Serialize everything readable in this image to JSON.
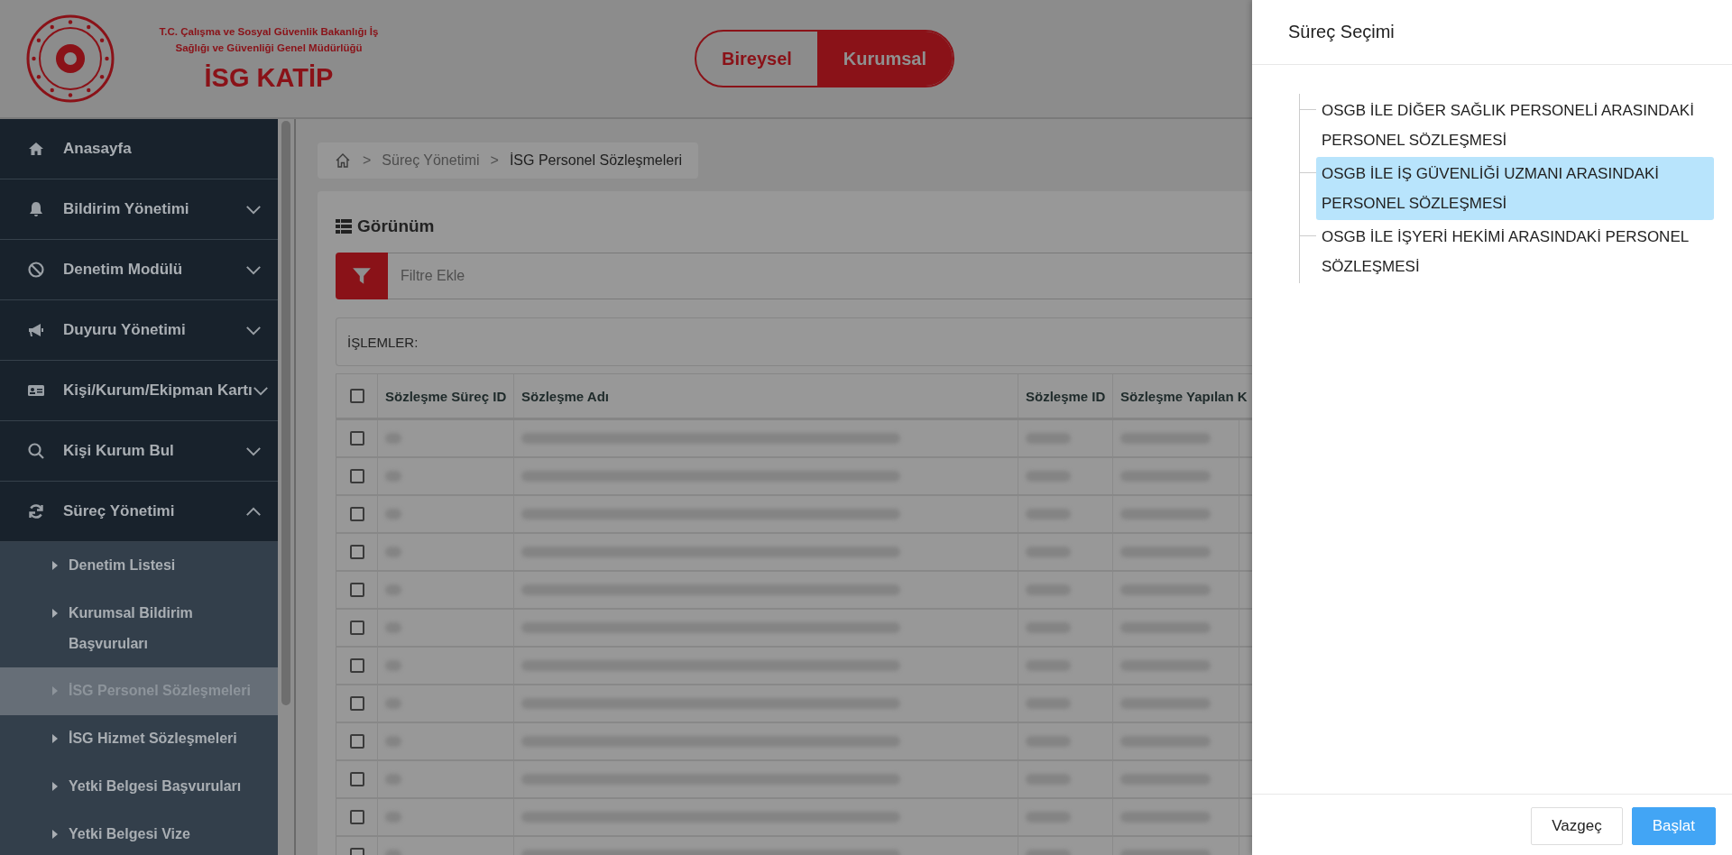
{
  "header": {
    "ministry": "T.C. Çalışma ve Sosyal Güvenlik Bakanlığı İş Sağlığı ve Güvenliği Genel Müdürlüğü",
    "app_name": "İSG KATİP",
    "toggle": [
      {
        "label": "Bireysel",
        "selected": false
      },
      {
        "label": "Kurumsal",
        "selected": true
      }
    ]
  },
  "sidebar": {
    "items": [
      {
        "label": "Anasayfa",
        "kind": "link"
      },
      {
        "label": "Bildirim Yönetimi",
        "kind": "group",
        "expanded": false
      },
      {
        "label": "Denetim Modülü",
        "kind": "group",
        "expanded": false
      },
      {
        "label": "Duyuru Yönetimi",
        "kind": "group",
        "expanded": false
      },
      {
        "label": "Kişi/Kurum/Ekipman Kartı",
        "kind": "group",
        "expanded": false
      },
      {
        "label": "Kişi Kurum Bul",
        "kind": "group",
        "expanded": false
      },
      {
        "label": "Süreç Yönetimi",
        "kind": "group",
        "expanded": true,
        "children": [
          {
            "label": "Denetim Listesi",
            "selected": false
          },
          {
            "label": "Kurumsal Bildirim Başvuruları",
            "selected": false
          },
          {
            "label": "İSG Personel Sözleşmeleri",
            "selected": true
          },
          {
            "label": "İSG Hizmet Sözleşmeleri",
            "selected": false
          },
          {
            "label": "Yetki Belgesi Başvuruları",
            "selected": false
          },
          {
            "label": "Yetki Belgesi Vize",
            "selected": false
          }
        ]
      }
    ]
  },
  "breadcrumb": [
    {
      "separator": ">",
      "label": "Süreç Yönetimi"
    },
    {
      "separator": ">",
      "label": "İSG Personel Sözleşmeleri"
    }
  ],
  "panel": {
    "title": "Görünüm",
    "filter": {
      "placeholder": "Filtre Ekle"
    },
    "actions_label": "İŞLEMLER:"
  },
  "table": {
    "columns": [
      "Sözleşme Süreç ID",
      "Sözleşme Adı",
      "Sözleşme ID",
      "Sözleşme Yapılan K"
    ],
    "header_checked": false,
    "rows": [
      {
        "checked": false
      },
      {
        "checked": false
      },
      {
        "checked": false
      },
      {
        "checked": false
      },
      {
        "checked": false
      },
      {
        "checked": false
      },
      {
        "checked": false
      },
      {
        "checked": false
      },
      {
        "checked": false
      },
      {
        "checked": false
      },
      {
        "checked": false
      },
      {
        "checked": false
      }
    ]
  },
  "drawer": {
    "title": "Süreç Seçimi",
    "tree": [
      {
        "label": "OSGB İLE DİĞER SAĞLIK PERSONELİ ARASINDAKİ PERSONEL SÖZLEŞMESİ",
        "selected": false
      },
      {
        "label": "OSGB İLE İŞ GÜVENLİĞİ UZMANI ARASINDAKİ PERSONEL SÖZLEŞMESİ",
        "selected": true
      },
      {
        "label": "OSGB İLE İŞYERİ HEKİMİ ARASINDAKİ PERSONEL SÖZLEŞMESİ",
        "selected": false
      }
    ],
    "buttons": [
      {
        "label": "Vazgeç",
        "kind": "secondary"
      },
      {
        "label": "Başlat",
        "kind": "primary"
      }
    ]
  }
}
